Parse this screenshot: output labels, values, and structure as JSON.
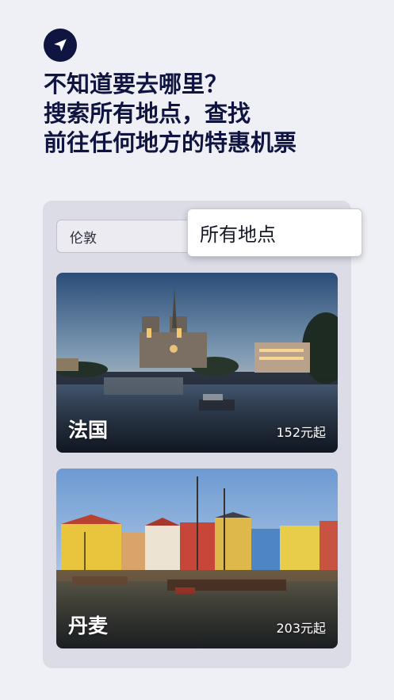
{
  "header": {
    "icon": "navigation-arrow-icon",
    "headline_lines": [
      "不知道要去哪里？",
      "搜索所有地点，查找",
      "前往任何地方的特惠机票"
    ]
  },
  "search": {
    "origin_value": "伦敦",
    "destination_option": "所有地点"
  },
  "destinations": [
    {
      "name": "法国",
      "price": "152元起",
      "image": "paris-notre-dame-dusk"
    },
    {
      "name": "丹麦",
      "price": "203元起",
      "image": "copenhagen-nyhavn-harbor"
    }
  ],
  "colors": {
    "background": "#eff0f5",
    "heading": "#0f1540",
    "panel": "#dcdce6"
  }
}
